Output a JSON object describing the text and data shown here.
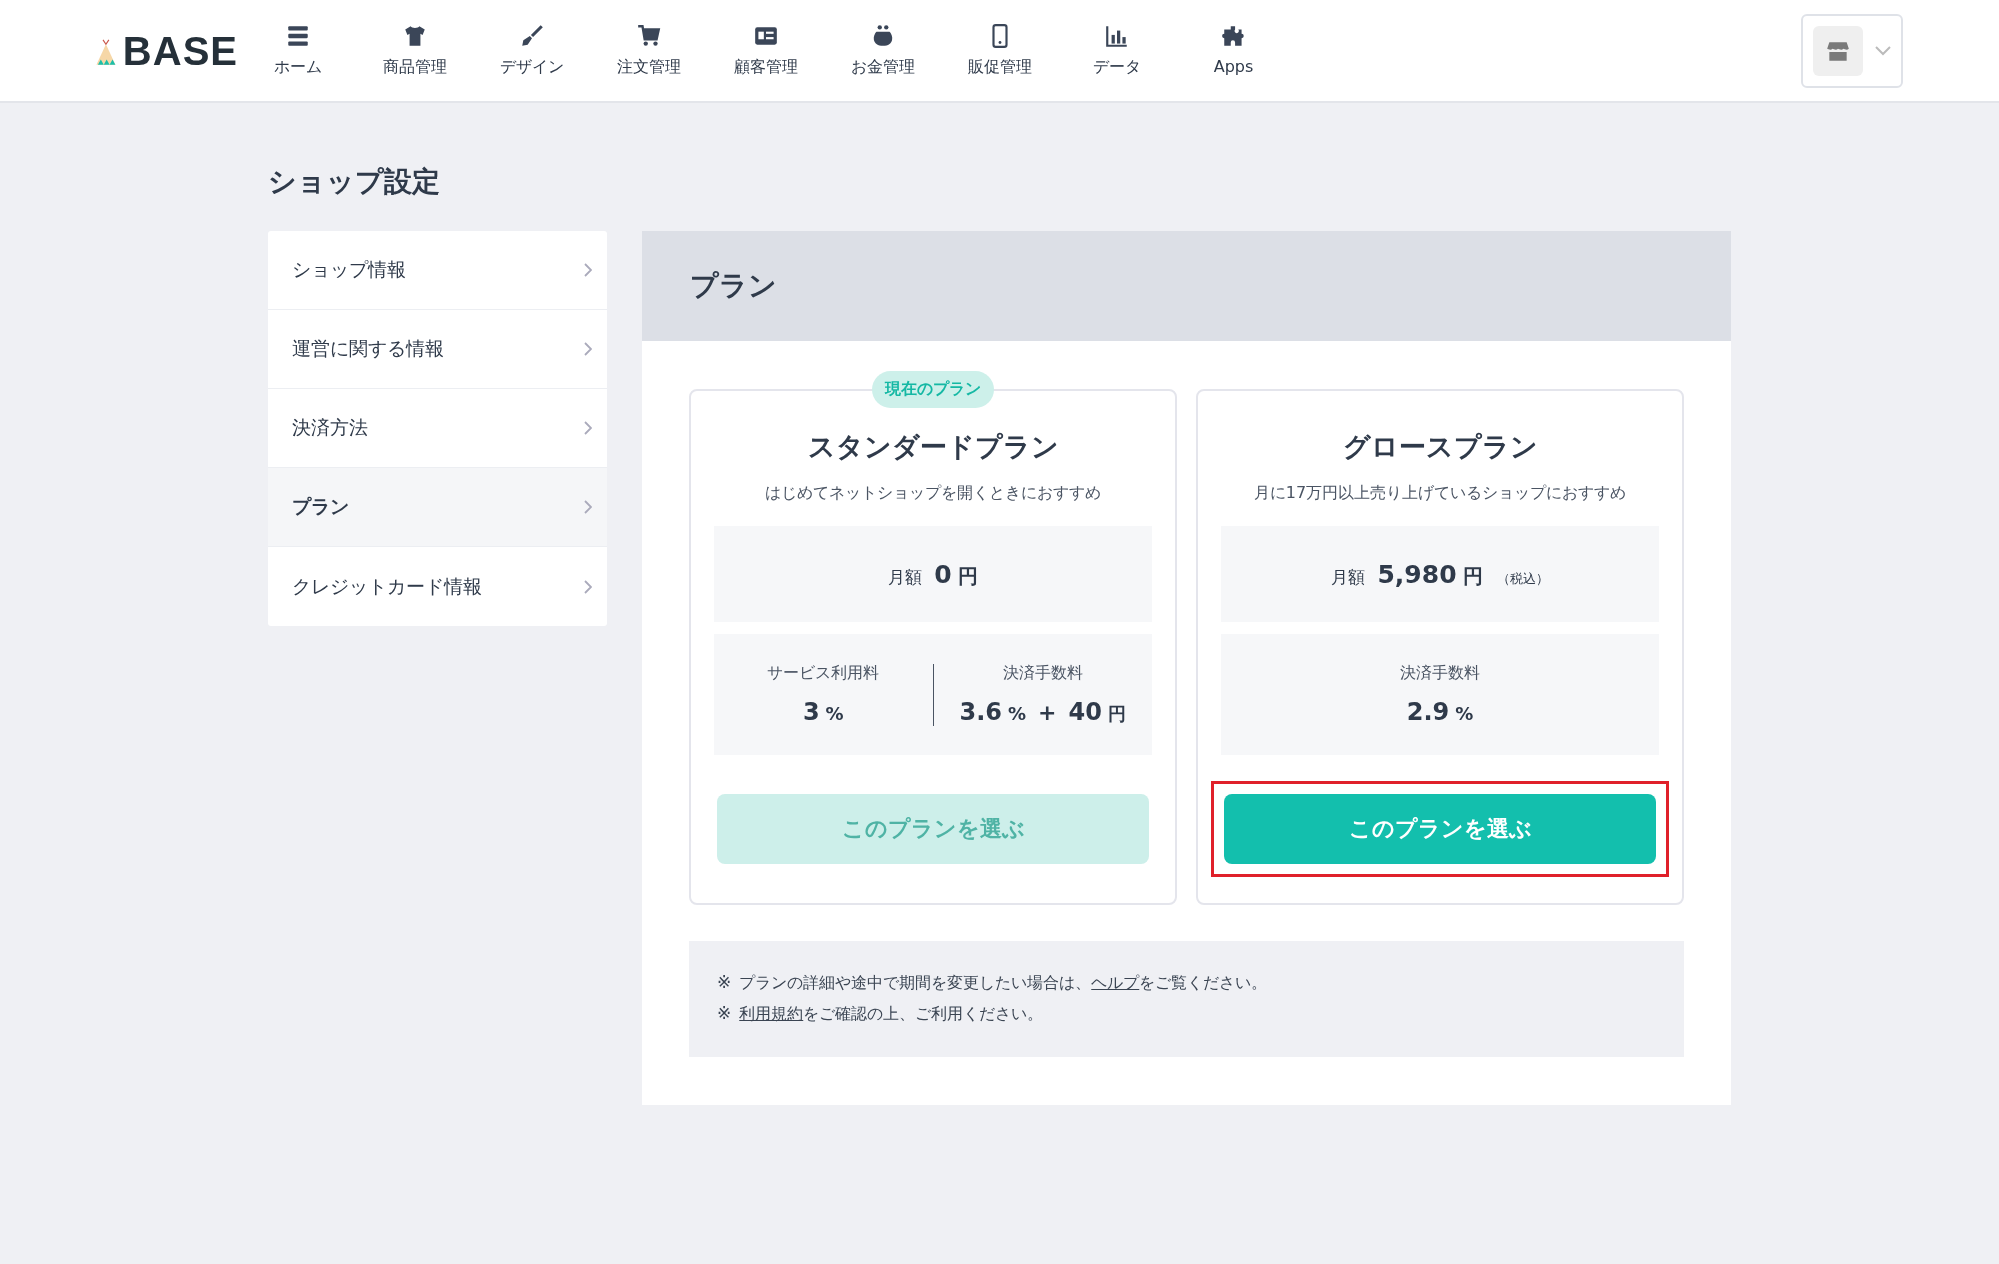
{
  "header": {
    "logo": "BASE",
    "nav": [
      {
        "label": "ホーム"
      },
      {
        "label": "商品管理"
      },
      {
        "label": "デザイン"
      },
      {
        "label": "注文管理"
      },
      {
        "label": "顧客管理"
      },
      {
        "label": "お金管理"
      },
      {
        "label": "販促管理"
      },
      {
        "label": "データ"
      },
      {
        "label": "Apps"
      }
    ]
  },
  "page_title": "ショップ設定",
  "sidebar": {
    "items": [
      {
        "label": "ショップ情報",
        "selected": false
      },
      {
        "label": "運営に関する情報",
        "selected": false
      },
      {
        "label": "決済方法",
        "selected": false
      },
      {
        "label": "プラン",
        "selected": true
      },
      {
        "label": "クレジットカード情報",
        "selected": false
      }
    ]
  },
  "panel": {
    "title": "プラン",
    "plans": [
      {
        "badge": "現在のプラン",
        "name": "スタンダードプラン",
        "description": "はじめてネットショップを開くときにおすすめ",
        "price": {
          "label": "月額",
          "amount": "0",
          "unit": "円"
        },
        "fees": [
          {
            "label": "サービス利用料",
            "value": [
              {
                "kind": "num",
                "text": "3"
              },
              {
                "kind": "unit",
                "text": "%"
              }
            ]
          },
          {
            "label": "決済手数料",
            "value": [
              {
                "kind": "num",
                "text": "3.6"
              },
              {
                "kind": "unit",
                "text": "%"
              },
              {
                "kind": "op",
                "text": "+"
              },
              {
                "kind": "num",
                "text": "40"
              },
              {
                "kind": "unit",
                "text": "円"
              }
            ]
          }
        ],
        "button": {
          "label": "このプランを選ぶ",
          "disabled": true,
          "highlighted": false
        }
      },
      {
        "name": "グロースプラン",
        "description": "月に17万円以上売り上げているショップにおすすめ",
        "price": {
          "label": "月額",
          "amount": "5,980",
          "unit": "円",
          "note": "（税込）"
        },
        "fees": [
          {
            "label": "決済手数料",
            "value": [
              {
                "kind": "num",
                "text": "2.9"
              },
              {
                "kind": "unit",
                "text": "%"
              }
            ]
          }
        ],
        "button": {
          "label": "このプランを選ぶ",
          "disabled": false,
          "highlighted": true
        }
      }
    ],
    "notes": [
      {
        "mark": "※",
        "before": "プランの詳細や途中で期間を変更したい場合は、",
        "link": "ヘルプ",
        "after": "をご覧ください。"
      },
      {
        "mark": "※",
        "link": "利用規約",
        "after": "をご確認の上、ご利用ください。"
      }
    ]
  }
}
